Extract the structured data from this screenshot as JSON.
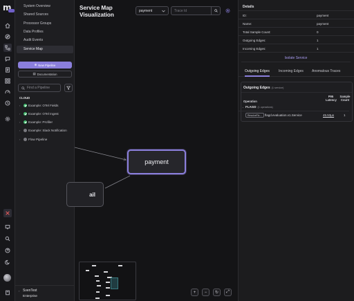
{
  "app": {
    "logo_text": "m",
    "logo_badge": "cloud"
  },
  "sidebar": {
    "nav": [
      {
        "label": "System Overview"
      },
      {
        "label": "Shared Sources"
      },
      {
        "label": "Processor Groups"
      },
      {
        "label": "Data Profiles"
      },
      {
        "label": "Audit Events"
      },
      {
        "label": "Service Map"
      }
    ],
    "active_nav": "Service Map",
    "new_pipeline_label": "New Pipeline",
    "documentation_label": "Documentation",
    "find_placeholder": "Find a Pipeline",
    "section_label": "CLOUD",
    "pipelines": [
      {
        "label": "Example: OTel Fields",
        "status": "ok"
      },
      {
        "label": "Example: OTel Ingest",
        "status": "ok"
      },
      {
        "label": "Example: Profiler",
        "status": "ok"
      },
      {
        "label": "Example: Slack Notification",
        "status": "off"
      },
      {
        "label": "Flow Pipeline",
        "status": "off"
      }
    ],
    "user": {
      "name": "SvenTest",
      "org": "Enterprise"
    }
  },
  "main": {
    "title": "Service Map Visualization",
    "service_select": "payment",
    "trace_placeholder": "Trace Id",
    "nodes": {
      "payment": "payment",
      "email": "ail"
    },
    "zoom_controls": {
      "zoom_in": "+",
      "zoom_out": "−",
      "reset": "↻",
      "fit": "⤢"
    }
  },
  "details": {
    "heading": "Details",
    "rows": [
      {
        "key": "ID:",
        "value": "payment"
      },
      {
        "key": "Name:",
        "value": "payment"
      },
      {
        "key": "Total Sample Count:",
        "value": "0"
      },
      {
        "key": "Outgoing Edges:",
        "value": "1"
      },
      {
        "key": "Incoming Edges:",
        "value": "1"
      }
    ],
    "isolate_label": "Isolate Service",
    "tabs": [
      "Outgoing Edges",
      "Incoming Edges",
      "Anomalous Traces"
    ],
    "active_tab": "Outgoing Edges",
    "edges": {
      "heading": "Outgoing Edges",
      "count_text": "(1 service)",
      "col_operation": "Operation",
      "col_latency": "P95 Latency",
      "col_count": "Sample Count",
      "group": "FLAGD",
      "group_count": "(1 operations)",
      "row": {
        "method": "ResolveFlo…",
        "operation": "flagd.evaluation.v1.Service",
        "latency": "45.53µs",
        "count": "1"
      }
    }
  },
  "colors": {
    "accent": "#8b7fdc",
    "success": "#3fb96b",
    "background": "#1c1c1e"
  }
}
